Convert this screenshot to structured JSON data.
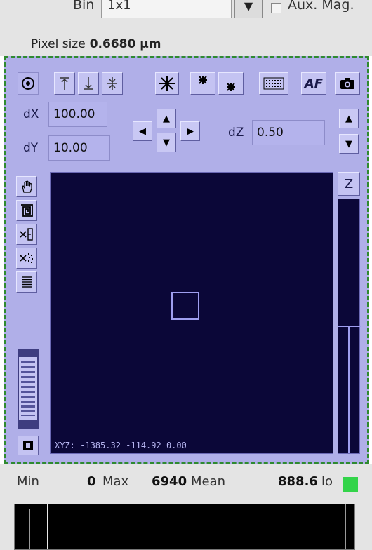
{
  "camera": {
    "bin_label": "Bin",
    "bin_value": "1x1",
    "aux_mag_label": "Aux. Mag.",
    "pixel_size_label": "Pixel size",
    "pixel_size_value": "0.6680 µm"
  },
  "stage": {
    "toolbar": {
      "af_label": "AF"
    },
    "dx_label": "dX",
    "dx_value": "100.00",
    "dy_label": "dY",
    "dy_value": "10.00",
    "dz_label": "dZ",
    "dz_value": "0.50",
    "z_label": "Z",
    "xyz_readout": "XYZ: -1385.32 -114.92 0.00"
  },
  "stats": {
    "min_label": "Min",
    "min_value": "0",
    "max_label": "Max",
    "max_value": "6940",
    "mean_label": "Mean",
    "mean_value": "888.6",
    "lo_label": "lo",
    "lo_color": "#33d44a"
  },
  "colors": {
    "panel_bg": "#b0afe8",
    "viewport_bg": "#0b0738",
    "panel_border": "#2f8a2f"
  }
}
